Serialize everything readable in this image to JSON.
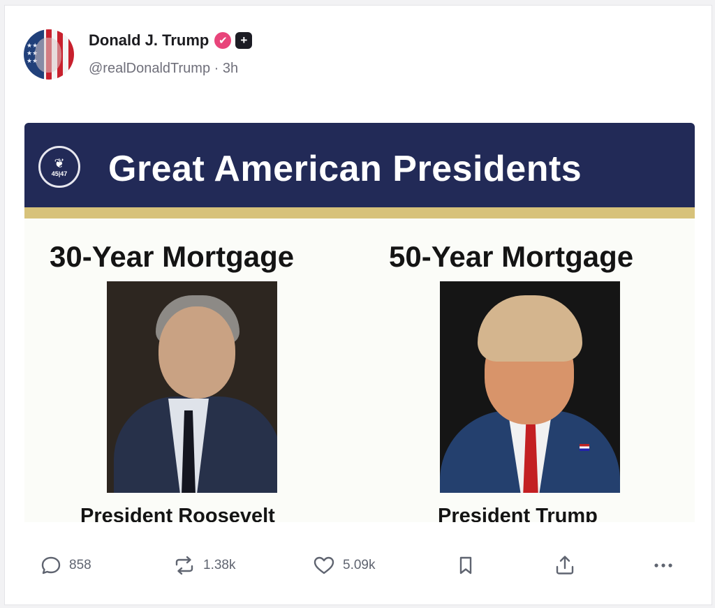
{
  "post": {
    "author_name": "Donald J. Trump",
    "handle": "@realDonaldTrump",
    "separator": "·",
    "time": "3h",
    "verified_glyph": "✔",
    "plus_glyph": "+"
  },
  "image": {
    "banner_title": "Great American Presidents",
    "seal_text": "45|47",
    "left_column_title": "30-Year Mortgage",
    "right_column_title": "50-Year Mortgage",
    "left_caption": "President Roosevelt",
    "right_caption": "President Trump"
  },
  "actions": {
    "replies": "858",
    "reposts": "1.38k",
    "likes": "5.09k"
  },
  "colors": {
    "banner": "#222a57",
    "gold_stripe": "#d7c27a",
    "verified_badge": "#e8447a",
    "icon_gray": "#5f6470"
  }
}
